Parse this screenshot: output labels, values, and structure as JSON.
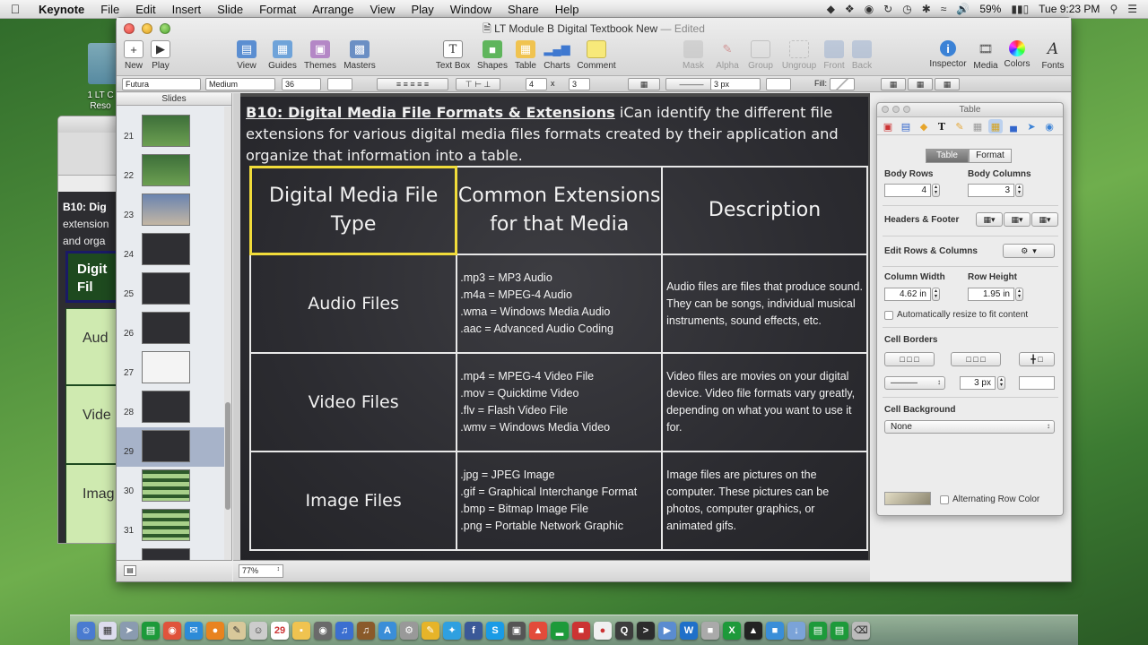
{
  "menubar": {
    "app": "Keynote",
    "items": [
      "File",
      "Edit",
      "Insert",
      "Slide",
      "Format",
      "Arrange",
      "View",
      "Play",
      "Window",
      "Share",
      "Help"
    ],
    "battery": "59%",
    "clock": "Tue 9:23 PM"
  },
  "desktop": {
    "icon_label": "1 LT C\nReso"
  },
  "background_window": {
    "heading_bold": "B10: Dig",
    "line2": "extension",
    "line3": "and orga",
    "head_cell": "Digit\nFil",
    "cells": [
      "Aud",
      "Vide",
      "Imag"
    ]
  },
  "window": {
    "title": "LT Module B Digital Textbook New",
    "status": "— Edited"
  },
  "toolbar": {
    "left": [
      {
        "label": "New",
        "icon": "plus-icon"
      },
      {
        "label": "Play",
        "icon": "play-icon"
      }
    ],
    "view": [
      {
        "label": "View",
        "icon": "view-icon"
      },
      {
        "label": "Guides",
        "icon": "guides-icon"
      },
      {
        "label": "Themes",
        "icon": "themes-icon"
      },
      {
        "label": "Masters",
        "icon": "masters-icon"
      }
    ],
    "insert": [
      {
        "label": "Text Box",
        "icon": "textbox-icon"
      },
      {
        "label": "Shapes",
        "icon": "shapes-icon"
      },
      {
        "label": "Table",
        "icon": "table-icon"
      },
      {
        "label": "Charts",
        "icon": "charts-icon"
      },
      {
        "label": "Comment",
        "icon": "comment-icon"
      }
    ],
    "arrange": [
      {
        "label": "Mask",
        "icon": "mask-icon"
      },
      {
        "label": "Alpha",
        "icon": "alpha-icon"
      },
      {
        "label": "Group",
        "icon": "group-icon"
      },
      {
        "label": "Ungroup",
        "icon": "ungroup-icon"
      },
      {
        "label": "Front",
        "icon": "front-icon"
      },
      {
        "label": "Back",
        "icon": "back-icon"
      }
    ],
    "right": [
      {
        "label": "Inspector",
        "icon": "inspector-icon"
      },
      {
        "label": "Media",
        "icon": "media-icon"
      },
      {
        "label": "Colors",
        "icon": "colors-icon"
      },
      {
        "label": "Fonts",
        "icon": "fonts-icon"
      }
    ]
  },
  "formatbar": {
    "font": "Futura",
    "weight": "Medium",
    "size": "36",
    "rows": "4",
    "cols": "3",
    "times": "x",
    "stroke": "3 px",
    "fill_label": "Fill:"
  },
  "navigator": {
    "header": "Slides",
    "slides": [
      {
        "num": "21",
        "style": "green"
      },
      {
        "num": "22",
        "style": "green"
      },
      {
        "num": "23",
        "style": "photo"
      },
      {
        "num": "24",
        "style": "dark"
      },
      {
        "num": "25",
        "style": "dark"
      },
      {
        "num": "26",
        "style": "dark"
      },
      {
        "num": "27",
        "style": "white"
      },
      {
        "num": "28",
        "style": "dark"
      },
      {
        "num": "29",
        "style": "dark",
        "selected": true
      },
      {
        "num": "30",
        "style": "greenlight"
      },
      {
        "num": "31",
        "style": "greenlight"
      },
      {
        "num": "32",
        "style": "dark"
      }
    ]
  },
  "zoom": "77%",
  "slide": {
    "heading_bold": "B10: Digital Media File Formats & Extensions",
    "heading_rest": " iCan identify the different file extensions for various digital media files formats created by their application and organize that information into a table.",
    "table": {
      "headers": [
        "Digital Media File Type",
        "Common Extensions for that Media",
        "Description"
      ],
      "rows": [
        {
          "type": "Audio Files",
          "extensions": ".mp3 = MP3 Audio\n.m4a = MPEG-4 Audio\n.wma = Windows Media Audio\n.aac = Advanced Audio Coding",
          "description": "Audio files are files that produce sound.  They can be songs, individual musical instruments, sound effects, etc."
        },
        {
          "type": "Video Files",
          "extensions": ".mp4 = MPEG-4 Video File\n.mov = Quicktime Video\n.flv = Flash Video File\n.wmv = Windows Media Video",
          "description": "Video files are movies on your digital device.  Video file formats vary greatly, depending on what you want to use it for."
        },
        {
          "type": "Image Files",
          "extensions": ".jpg = JPEG Image\n.gif = Graphical Interchange Format\n.bmp = Bitmap Image File\n.png = Portable Network Graphic",
          "description": "Image files are pictures on the computer.  These pictures can be photos, computer graphics, or animated gifs."
        }
      ]
    }
  },
  "inspector": {
    "title": "Table",
    "tabs": [
      "Table",
      "Format"
    ],
    "active_tab": "Table",
    "body_rows_label": "Body Rows",
    "body_rows": "4",
    "body_cols_label": "Body Columns",
    "body_cols": "3",
    "headers_footer_label": "Headers & Footer",
    "edit_rows_cols_label": "Edit Rows & Columns",
    "col_width_label": "Column Width",
    "col_width": "4.62 in",
    "row_height_label": "Row Height",
    "row_height": "1.95 in",
    "auto_resize_label": "Automatically resize to fit content",
    "cell_borders_label": "Cell Borders",
    "border_width": "3 px",
    "cell_bg_label": "Cell Background",
    "cell_bg_value": "None",
    "alt_row_label": "Alternating Row Color"
  },
  "colors": {
    "selection_outline": "#f1dc3a",
    "slide_bg": "#2c2c31"
  }
}
